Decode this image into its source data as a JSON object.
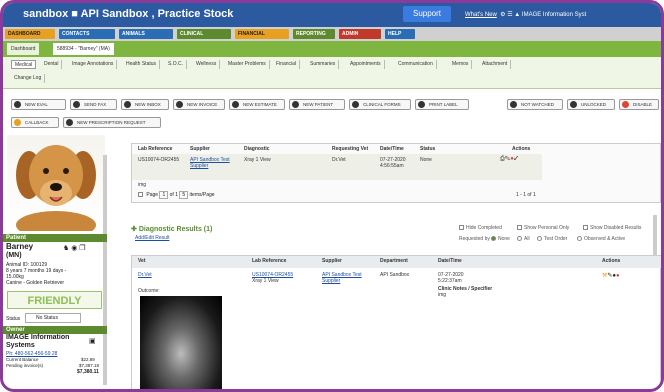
{
  "app": {
    "title": "sandbox  ■  API Sandbox , Practice Stock",
    "support": "Support",
    "whats_new": "What's New",
    "account": "IMAGE Information Syst"
  },
  "modules": [
    {
      "label": "DASHBOARD",
      "color": "#e8a020"
    },
    {
      "label": "CONTACTS",
      "color": "#2b6db5"
    },
    {
      "label": "ANIMALS",
      "color": "#2b6db5"
    },
    {
      "label": "CLINICAL",
      "color": "#5d8a2e"
    },
    {
      "label": "FINANCIAL",
      "color": "#e8a020"
    },
    {
      "label": "REPORTING",
      "color": "#5d8a2e"
    },
    {
      "label": "ADMIN",
      "color": "#c0392b"
    },
    {
      "label": "HELP",
      "color": "#2b6db5"
    }
  ],
  "tabs": {
    "t1": "Dashboard",
    "t2": "588934 - \"Barney\" (MA)"
  },
  "subnav": [
    "Medical",
    "Dental",
    "Image Annotations",
    "Health Status",
    "S.O.C.",
    "Wellness",
    "Master Problems",
    "Financial",
    "Summaries",
    "Appointments",
    "Communication",
    "Memos",
    "Attachment",
    "Change Log"
  ],
  "actions": [
    "NEW EVAL",
    "SEND FAX",
    "NEW INBOX",
    "NEW INVOICE",
    "NEW ESTIMATE",
    "NEW PATIENT",
    "CLINICAL FORMS",
    "PRINT LABEL",
    "NOT WATCHED",
    "UNLOCKED",
    "DISABLE",
    "CALLBACK",
    "NEW PRESCRIPTION REQUEST"
  ],
  "patient": {
    "header": "Patient",
    "name": "Barney",
    "suffix": "(MN)",
    "id": "Animal ID: 100129",
    "age": "8 years 7 months 19 days -",
    "weight": "15.00kg",
    "breed": "Canine - Golden Retriever",
    "friendly": "FRIENDLY",
    "status_label": "Status",
    "status_value": "No Status"
  },
  "owner": {
    "header": "Owner",
    "name": "IMAGE Information",
    "name2": "Systems",
    "phone": "Ph: 480-562-456-59 28",
    "balance_label": "Current Balance",
    "balance": "$22.89",
    "pending_label": "Pending invoice(s)",
    "pending": "$7,387.18",
    "total": "$7,380.11"
  },
  "lab": {
    "headers": [
      "Lab Reference",
      "Supplier",
      "Diagnostic",
      "Requesting Vet",
      "Date/Time",
      "Status",
      "Actions"
    ],
    "row": {
      "ref": "US10074-OR2455",
      "supplier": "API Sandbox Test Supplier",
      "diagnostic": "Xray 1 View",
      "vet": "Dr.Vet",
      "date": "07-27-2020",
      "time": "4:56:55am",
      "status": "None"
    },
    "footer_page": "Page",
    "footer_of": "of 1",
    "footer_items": "items/Page",
    "footer_count": "1 - 1 of 1",
    "page_num": "1",
    "per_page": "5",
    "extra": "img"
  },
  "dx": {
    "title": "Diagnostic Results (1)",
    "link": "Add/Edit Result",
    "filters": [
      "Hide Completed",
      "Show Personal Only",
      "Show Disabled Results"
    ],
    "radio_label": "Requested by",
    "radios": [
      "None",
      "All",
      "Test Order",
      "Observed & Active"
    ]
  },
  "results": {
    "headers": [
      "Vet",
      "Lab Reference",
      "Supplier",
      "Department",
      "Date/Time",
      "Actions"
    ],
    "vet": "Dr.Vet",
    "ref": "US10074-OR2455",
    "ref2": "Xray 1 View",
    "supplier": "API Sandbox Test Supplier",
    "dept": "API Sandbox",
    "date": "07-27-2020",
    "time": "5:22:37am",
    "notes": "Clinic Notes / Specifier",
    "notes2": "img",
    "outcome": "Outcome:"
  }
}
